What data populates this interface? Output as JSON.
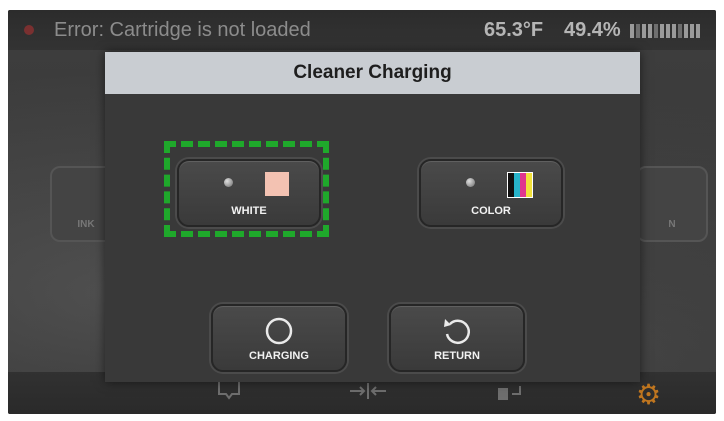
{
  "statusbar": {
    "error_text": "Error: Cartridge is not loaded",
    "temperature": "65.3°F",
    "humidity": "49.4%",
    "signal_icon": "signal-bars-icon"
  },
  "background": {
    "left_card_label": "INK",
    "right_card_label": "N"
  },
  "dialog": {
    "title": "Cleaner Charging",
    "buttons": {
      "white": {
        "label": "WHITE",
        "swatch_color": "#f3c2b2"
      },
      "color": {
        "label": "COLOR",
        "swatch_colors": [
          "#111111",
          "#27b3c9",
          "#e0358f",
          "#f1e13a"
        ]
      },
      "charging": {
        "label": "CHARGING",
        "icon": "circle-icon"
      },
      "return": {
        "label": "RETURN",
        "icon": "return-arrow-icon"
      }
    },
    "highlight_color": "#1fa82b"
  },
  "bottom_bar": {
    "gear_color": "#c0761f"
  }
}
